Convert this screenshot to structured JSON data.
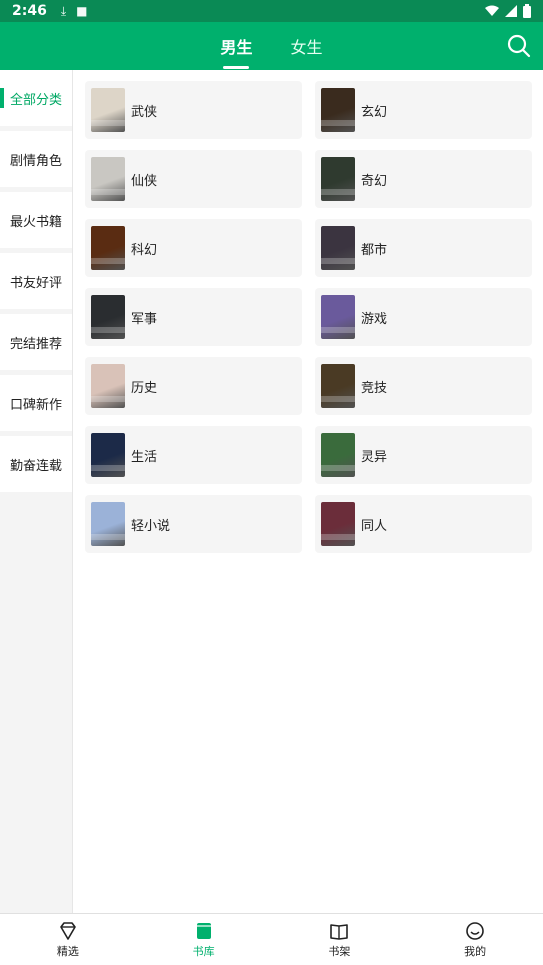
{
  "status": {
    "time": "2:46"
  },
  "tabs": [
    {
      "label": "男生",
      "active": true
    },
    {
      "label": "女生",
      "active": false
    }
  ],
  "sidebar": {
    "items": [
      {
        "label": "全部分类",
        "active": true
      },
      {
        "label": "剧情角色",
        "active": false
      },
      {
        "label": "最火书籍",
        "active": false
      },
      {
        "label": "书友好评",
        "active": false
      },
      {
        "label": "完结推荐",
        "active": false
      },
      {
        "label": "口碑新作",
        "active": false
      },
      {
        "label": "勤奋连载",
        "active": false
      }
    ]
  },
  "categories": [
    {
      "label": "武侠",
      "color": "#ddd5c8"
    },
    {
      "label": "玄幻",
      "color": "#3a2b1e"
    },
    {
      "label": "仙侠",
      "color": "#c9c7c2"
    },
    {
      "label": "奇幻",
      "color": "#2f3a2f"
    },
    {
      "label": "科幻",
      "color": "#5a2c12"
    },
    {
      "label": "都市",
      "color": "#3b3440"
    },
    {
      "label": "军事",
      "color": "#2a2d30"
    },
    {
      "label": "游戏",
      "color": "#6a5a9c"
    },
    {
      "label": "历史",
      "color": "#d9c2b8"
    },
    {
      "label": "竞技",
      "color": "#4a3a24"
    },
    {
      "label": "生活",
      "color": "#1c2a48"
    },
    {
      "label": "灵异",
      "color": "#3a6b3c"
    },
    {
      "label": "轻小说",
      "color": "#9bb2d8"
    },
    {
      "label": "同人",
      "color": "#6b2d3a"
    }
  ],
  "bottom_nav": [
    {
      "label": "精选",
      "icon": "diamond-icon",
      "active": false
    },
    {
      "label": "书库",
      "icon": "book-icon",
      "active": true
    },
    {
      "label": "书架",
      "icon": "open-book-icon",
      "active": false
    },
    {
      "label": "我的",
      "icon": "smile-icon",
      "active": false
    }
  ],
  "colors": {
    "accent": "#00b06d",
    "status": "#0a8a55"
  }
}
